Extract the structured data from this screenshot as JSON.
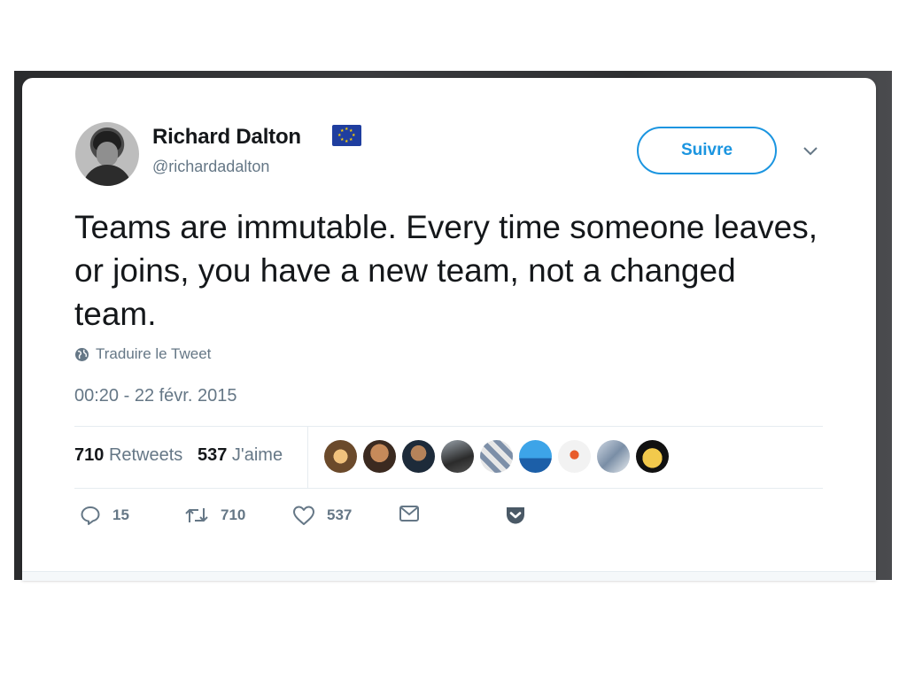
{
  "user": {
    "name": "Richard Dalton",
    "handle": "@richardadalton"
  },
  "follow_label": "Suivre",
  "tweet_text": "Teams are immutable. Every time someone leaves, or joins, you have a new team, not a changed team.",
  "translate_label": "Traduire le Tweet",
  "timestamp": "00:20 - 22 févr. 2015",
  "stats": {
    "retweets_count": "710",
    "retweets_label": "Retweets",
    "likes_count": "537",
    "likes_label": "J'aime"
  },
  "actions": {
    "replies": "15",
    "retweets": "710",
    "likes": "537"
  },
  "icons": [
    "globe-icon",
    "chevron-down-icon",
    "reply-icon",
    "retweet-icon",
    "heart-icon",
    "message-icon",
    "pocket-icon",
    "eu-flag-icon"
  ],
  "colors": {
    "accent": "#1b95e0",
    "text": "#14171a",
    "secondary": "#657786",
    "pocket": "#4a5966"
  }
}
